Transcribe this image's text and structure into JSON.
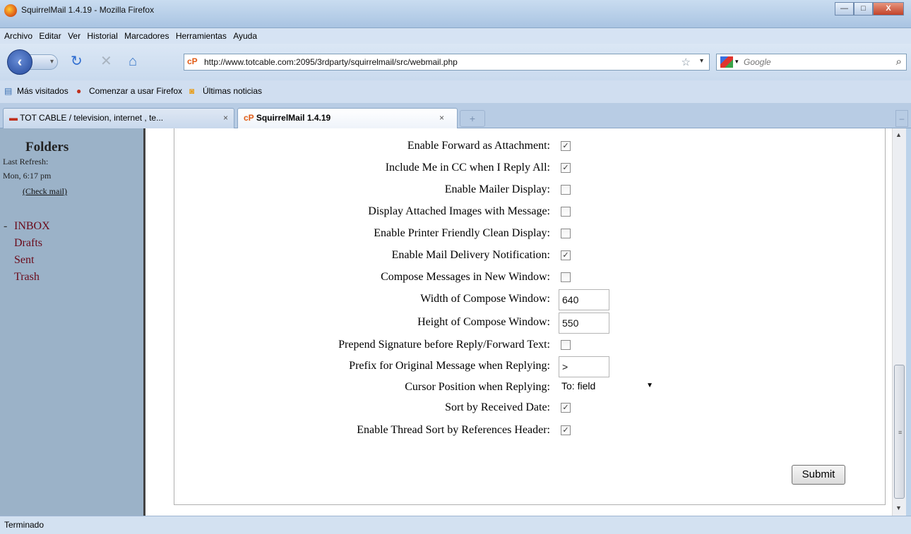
{
  "window": {
    "title": "SquirrelMail 1.4.19 - Mozilla Firefox",
    "minimize": "—",
    "maximize": "□",
    "close": "X"
  },
  "menubar": [
    "Archivo",
    "Editar",
    "Ver",
    "Historial",
    "Marcadores",
    "Herramientas",
    "Ayuda"
  ],
  "navigation": {
    "back_icon": "back-arrow-icon",
    "url": "http://www.totcable.com:2095/3rdparty/squirrelmail/src/webmail.php",
    "site_icon_text": "cP",
    "search_placeholder": "Google"
  },
  "bookmarks": [
    "Más visitados",
    "Comenzar a usar Firefox",
    "Últimas noticias"
  ],
  "tabs": [
    {
      "label": "TOT CABLE / television, internet , te...",
      "active": false
    },
    {
      "label": "SquirrelMail 1.4.19",
      "active": true
    }
  ],
  "sidebar": {
    "heading": "Folders",
    "last_refresh_label": "Last Refresh:",
    "last_refresh_time": "Mon, 6:17 pm",
    "check_mail": "(Check mail)",
    "collapse_marker": "-",
    "folders": [
      "INBOX",
      "Drafts",
      "Sent",
      "Trash"
    ]
  },
  "options": [
    {
      "label": "Enable Forward as Attachment:",
      "type": "checkbox",
      "checked": true
    },
    {
      "label": "Include Me in CC when I Reply All:",
      "type": "checkbox",
      "checked": true
    },
    {
      "label": "Enable Mailer Display:",
      "type": "checkbox",
      "checked": false
    },
    {
      "label": "Display Attached Images with Message:",
      "type": "checkbox",
      "checked": false
    },
    {
      "label": "Enable Printer Friendly Clean Display:",
      "type": "checkbox",
      "checked": false
    },
    {
      "label": "Enable Mail Delivery Notification:",
      "type": "checkbox",
      "checked": true
    },
    {
      "label": "Compose Messages in New Window:",
      "type": "checkbox",
      "checked": false
    },
    {
      "label": "Width of Compose Window:",
      "type": "text",
      "value": "640"
    },
    {
      "label": "Height of Compose Window:",
      "type": "text",
      "value": "550"
    },
    {
      "label": "Prepend Signature before Reply/Forward Text:",
      "type": "checkbox",
      "checked": false
    },
    {
      "label": "Prefix for Original Message when Replying:",
      "type": "text",
      "value": ">"
    },
    {
      "label": "Cursor Position when Replying:",
      "type": "select",
      "value": "To: field"
    },
    {
      "label": "Sort by Received Date:",
      "type": "checkbox",
      "checked": true
    },
    {
      "label": "Enable Thread Sort by References Header:",
      "type": "checkbox",
      "checked": true
    }
  ],
  "submit_label": "Submit",
  "status": "Terminado"
}
